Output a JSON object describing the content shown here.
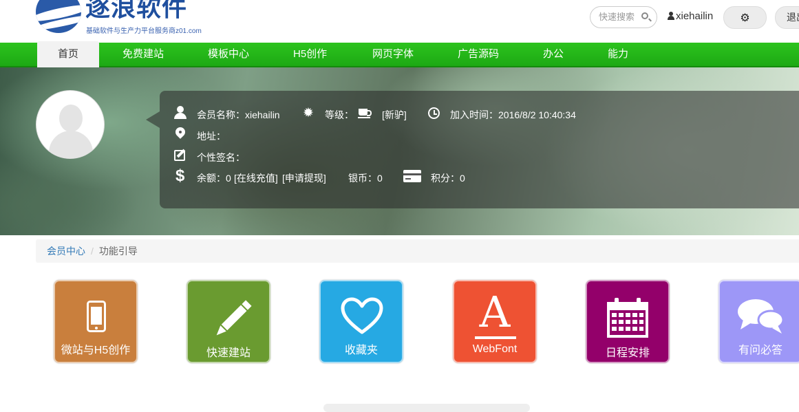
{
  "header": {
    "logo_title": "逐浪软件",
    "logo_subtitle": "基础软件与生产力平台服务商z01.com",
    "search_placeholder": "快速搜索",
    "username": "xiehailin",
    "logout_label": "退出"
  },
  "nav": {
    "items": [
      {
        "label": "首页",
        "active": true
      },
      {
        "label": "免费建站"
      },
      {
        "label": "模板中心"
      },
      {
        "label": "H5创作"
      },
      {
        "label": "网页字体"
      },
      {
        "label": "广告源码"
      },
      {
        "label": "办公"
      },
      {
        "label": "能力"
      }
    ]
  },
  "profile": {
    "member_name": "会员名称：xiehailin",
    "level_label": "等级：",
    "level_value": "[新驴]",
    "join_time": "加入时间：2016/8/2 10:40:34",
    "address": "地址：",
    "signature": "个性签名：",
    "balance": "余额：0",
    "recharge": "[在线充值]",
    "withdraw": "[申请提现]",
    "silver": "银币：0",
    "points": "积分：0"
  },
  "breadcrumb": {
    "root": "会员中心",
    "separator": "/",
    "current": "功能引导"
  },
  "tiles": [
    {
      "label": "微站与H5创作",
      "color": "#c97f3d",
      "icon": "phone-icon"
    },
    {
      "label": "快速建站",
      "color": "#6a9b30",
      "icon": "pencil-icon"
    },
    {
      "label": "收藏夹",
      "color": "#26a9e3",
      "icon": "heart-icon"
    },
    {
      "label": "WebFont",
      "color": "#ee5233",
      "icon": "font-a-icon",
      "glyph": "A"
    },
    {
      "label": "日程安排",
      "color": "#93006a",
      "icon": "calendar-icon"
    },
    {
      "label": "有问必答",
      "color": "#9d97f7",
      "icon": "chat-icon"
    }
  ],
  "colors": {
    "nav_green": "#1da914",
    "link_blue": "#337ab7"
  }
}
